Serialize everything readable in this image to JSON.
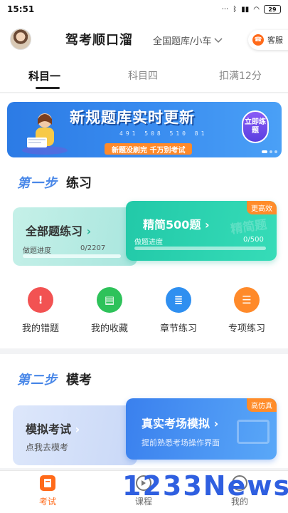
{
  "status": {
    "time": "15:51",
    "battery": "29"
  },
  "header": {
    "title": "驾考顺口溜",
    "bank_select": "全国题库/小车",
    "service_label": "客服"
  },
  "tabs": [
    {
      "label": "科目一",
      "active": true
    },
    {
      "label": "科目四",
      "active": false
    },
    {
      "label": "扣满12分",
      "active": false
    }
  ],
  "banner": {
    "title": "新规题库实时更新",
    "stats": "491 508 510 81",
    "slogan": "新题没刷完  千万别考试",
    "cta": "立即练题"
  },
  "section1": {
    "step": "第一步",
    "title": "练习",
    "all_practice": {
      "label": "全部题练习",
      "progress_label": "做题进度",
      "progress_value": "0/2207",
      "progress_fraction": 0
    },
    "simple500": {
      "label": "精简500题",
      "badge": "更高效",
      "watermark": "精简题",
      "progress_label": "做题进度",
      "progress_value": "0/500",
      "progress_fraction": 0
    },
    "grid": [
      {
        "label": "我的错题",
        "icon": "error-icon",
        "glyph": "!",
        "color": "#f25252"
      },
      {
        "label": "我的收藏",
        "icon": "favorite-icon",
        "glyph": "▤",
        "color": "#2ec25a"
      },
      {
        "label": "章节练习",
        "icon": "chapter-icon",
        "glyph": "≣",
        "color": "#2f8ff0"
      },
      {
        "label": "专项练习",
        "icon": "special-icon",
        "glyph": "☰",
        "color": "#ff8a2a"
      }
    ]
  },
  "section2": {
    "step": "第二步",
    "title": "模考",
    "mock": {
      "label": "模拟考试",
      "sub": "点我去模考"
    },
    "real": {
      "label": "真实考场模拟",
      "sub": "提前熟悉考场操作界面",
      "badge": "高仿真"
    }
  },
  "nav": [
    {
      "label": "考试",
      "active": true,
      "icon": "exam-icon"
    },
    {
      "label": "课程",
      "active": false,
      "icon": "course-icon"
    },
    {
      "label": "我的",
      "active": false,
      "icon": "profile-icon"
    }
  ],
  "watermark_brand": "1233News",
  "colors": {
    "accent": "#ff6a1a",
    "step_blue": "#4a88e8",
    "teal": "#22c9a8",
    "blue": "#3a80ee"
  }
}
